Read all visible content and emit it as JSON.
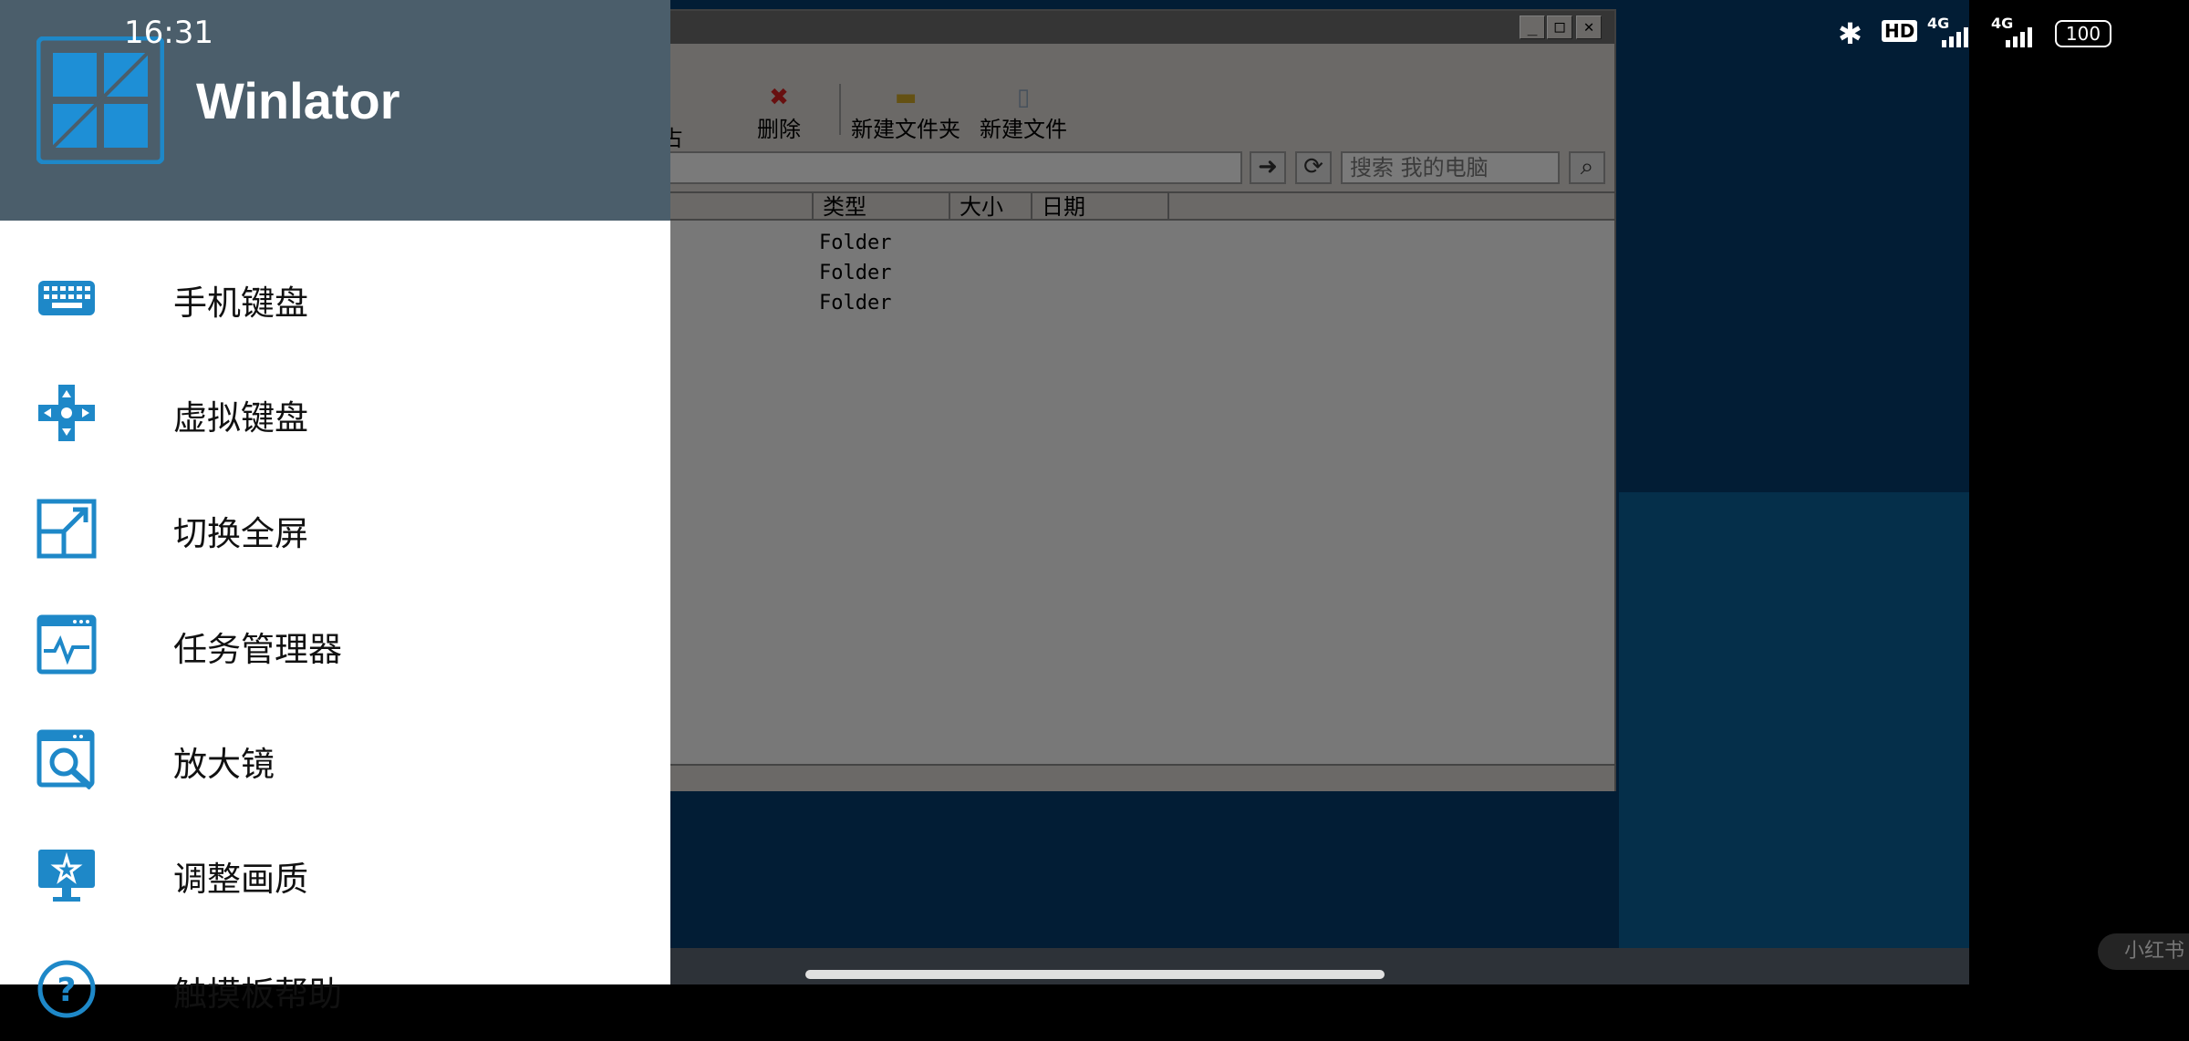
{
  "status_bar": {
    "time": "16:31",
    "hd_label": "HD",
    "net1": "4G",
    "net2": "4G",
    "battery": "100"
  },
  "drawer": {
    "app_name": "Winlator",
    "items": [
      {
        "label": "手机键盘",
        "icon": "keyboard-icon"
      },
      {
        "label": "虚拟键盘",
        "icon": "dpad-icon"
      },
      {
        "label": "切换全屏",
        "icon": "fullscreen-icon"
      },
      {
        "label": "任务管理器",
        "icon": "activity-monitor-icon"
      },
      {
        "label": "放大镜",
        "icon": "magnifier-icon"
      },
      {
        "label": "调整画质",
        "icon": "display-quality-icon"
      },
      {
        "label": "触摸板帮助",
        "icon": "help-icon"
      }
    ]
  },
  "explorer": {
    "toolbar": {
      "delete_label": "删除",
      "new_folder_label": "新建文件夹",
      "new_file_label": "新建文件",
      "partial_label": "占"
    },
    "search_placeholder": "搜索 我的电脑",
    "columns": [
      "类型",
      "大小",
      "日期"
    ],
    "rows": [
      {
        "type": "Folder"
      },
      {
        "type": "Folder"
      },
      {
        "type": "Folder"
      }
    ]
  },
  "watermark": "小红书",
  "colors": {
    "accent": "#1e88c8",
    "drawer_header": "#4b5e6b",
    "desktop": "#043a6a"
  }
}
